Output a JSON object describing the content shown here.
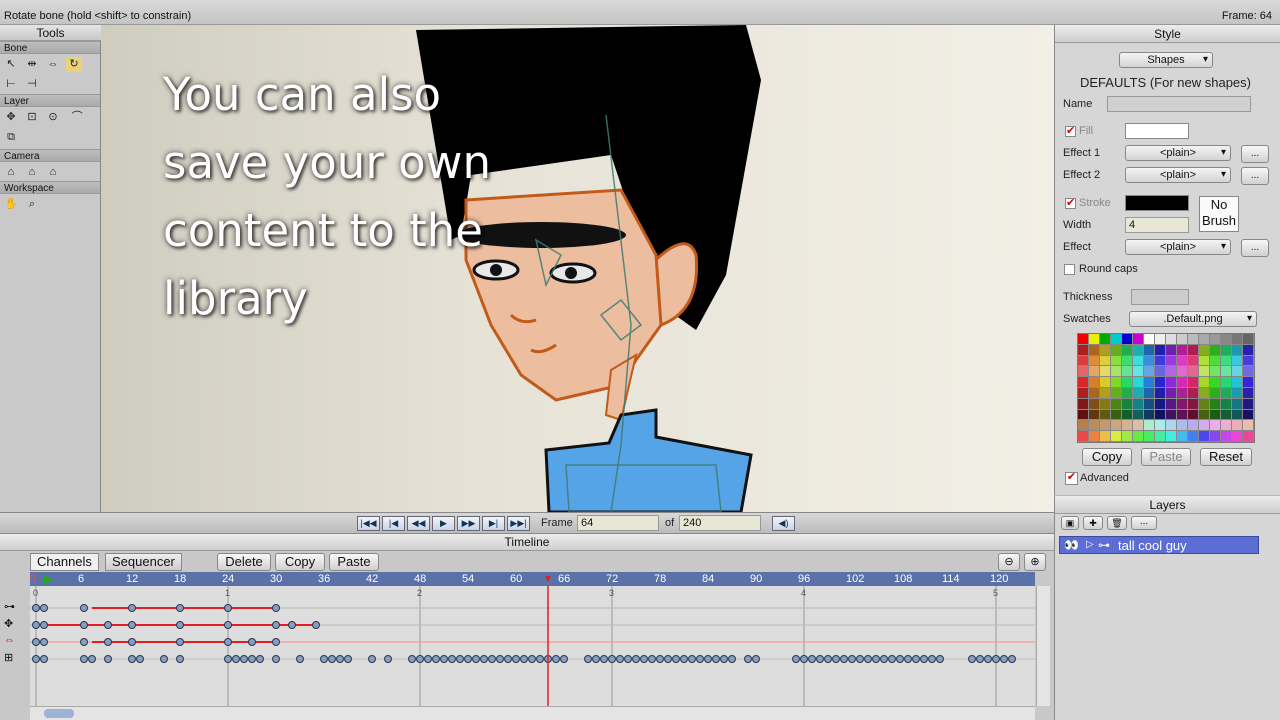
{
  "status": {
    "message": "Rotate bone (hold <shift> to constrain)",
    "frame": "Frame: 64"
  },
  "tools": {
    "title": "Tools",
    "sections": {
      "bone": "Bone",
      "layer": "Layer",
      "camera": "Camera",
      "workspace": "Workspace"
    }
  },
  "overlay": {
    "lines": [
      "You can also",
      "save your own",
      "content to the",
      "library"
    ]
  },
  "style": {
    "title": "Style",
    "mode": "Shapes",
    "defaults_label": "DEFAULTS (For new shapes)",
    "name_label": "Name",
    "fill_label": "Fill",
    "effect1_label": "Effect 1",
    "effect1_value": "<plain>",
    "effect2_label": "Effect 2",
    "effect2_value": "<plain>",
    "stroke_label": "Stroke",
    "width_label": "Width",
    "width_value": "4",
    "no_brush": "No Brush",
    "effect_label": "Effect",
    "effect_value": "<plain>",
    "round_caps": "Round caps",
    "thickness_label": "Thickness",
    "swatches_label": "Swatches",
    "swatches_value": ".Default.png",
    "copy": "Copy",
    "paste": "Paste",
    "reset": "Reset",
    "advanced": "Advanced",
    "more": "..."
  },
  "layers": {
    "title": "Layers",
    "items": [
      {
        "name": "tall cool guy"
      }
    ]
  },
  "transport": {
    "frame_label": "Frame",
    "frame_value": "64",
    "of_label": "of",
    "total": "240"
  },
  "timeline": {
    "title": "Timeline",
    "tabs": [
      "Channels",
      "Sequencer"
    ],
    "delete": "Delete",
    "copy": "Copy",
    "paste": "Paste",
    "ticks": [
      "0",
      "6",
      "12",
      "18",
      "24",
      "30",
      "36",
      "42",
      "48",
      "54",
      "60",
      "66",
      "72",
      "78",
      "84",
      "90",
      "96",
      "102",
      "108",
      "114",
      "120"
    ],
    "seconds": [
      "0",
      "1",
      "2",
      "3",
      "4",
      "5"
    ],
    "current_frame": 64
  },
  "colors": {
    "accent": "#5a72a8",
    "selected_layer": "#5c6ed4",
    "keyline": "#e02020"
  }
}
